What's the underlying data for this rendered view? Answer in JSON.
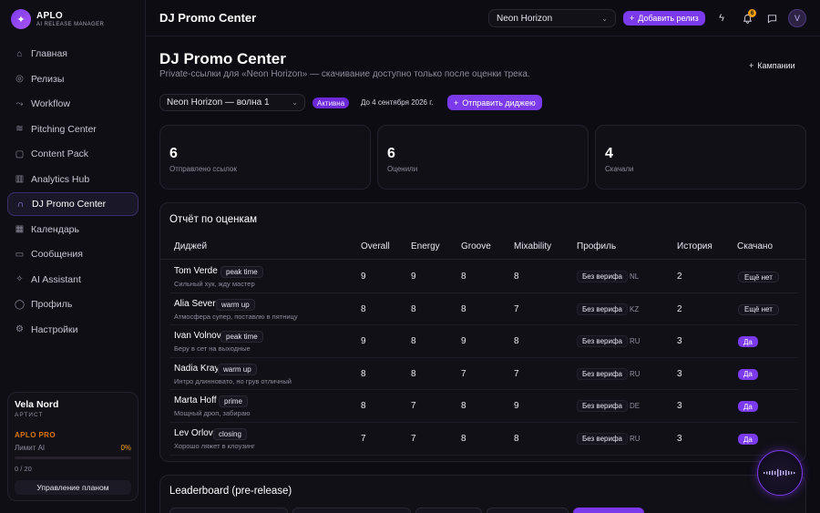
{
  "app": {
    "logo_name": "APLO",
    "logo_sub": "AI RELEASE MANAGER",
    "logo_icon": "sparkle-logo-icon"
  },
  "sidebar": {
    "items": [
      {
        "label": "Главная",
        "icon": "home-icon",
        "glyph": "⌂"
      },
      {
        "label": "Релизы",
        "icon": "disc-icon",
        "glyph": "◎"
      },
      {
        "label": "Workflow",
        "icon": "workflow-icon",
        "glyph": "⤳"
      },
      {
        "label": "Pitching Center",
        "icon": "broadcast-icon",
        "glyph": "≋"
      },
      {
        "label": "Content Pack",
        "icon": "package-icon",
        "glyph": "▢"
      },
      {
        "label": "Analytics Hub",
        "icon": "chart-icon",
        "glyph": "▥"
      },
      {
        "label": "DJ Promo Center",
        "icon": "headphones-icon",
        "glyph": "∩",
        "active": true
      },
      {
        "label": "Календарь",
        "icon": "calendar-icon",
        "glyph": "▦"
      },
      {
        "label": "Сообщения",
        "icon": "message-icon",
        "glyph": "▭"
      },
      {
        "label": "AI Assistant",
        "icon": "sparkle-icon",
        "glyph": "✧"
      },
      {
        "label": "Профиль",
        "icon": "user-icon",
        "glyph": "◯"
      },
      {
        "label": "Настройки",
        "icon": "gear-icon",
        "glyph": "⚙"
      }
    ],
    "plan": {
      "user_name": "Vela Nord",
      "role": "АРТИСТ",
      "plan_name": "APLO PRO",
      "limit_label": "Лимит AI",
      "limit_pct": "0%",
      "limit_fraction": 0,
      "count": "0 / 20",
      "manage_label": "Управление планом"
    }
  },
  "topbar": {
    "title": "DJ Promo Center",
    "release_select": "Neon Horizon",
    "add_release_label": "Добавить релиз",
    "notifications_count": "6",
    "avatar_letter": "V"
  },
  "main": {
    "title": "DJ Promo Center",
    "subtitle": "Private-ссылки для «Neon Horizon» — скачивание доступно только после оценки трека.",
    "campaigns_label": "Кампании",
    "wave_select": "Neon Horizon — волна 1",
    "status": "Активна",
    "deadline": "До 4 сентября 2026 г.",
    "send_digest_label": "Отправить диджею",
    "stats": [
      {
        "value": "6",
        "label": "Отправлено ссылок"
      },
      {
        "value": "6",
        "label": "Оценили"
      },
      {
        "value": "4",
        "label": "Скачали"
      }
    ],
    "report": {
      "title": "Отчёт по оценкам",
      "columns": [
        "Диджей",
        "Overall",
        "Energy",
        "Groove",
        "Mixability",
        "Профиль",
        "История",
        "Скачано"
      ],
      "rows": [
        {
          "name": "Tom Verde",
          "tag": "peak time",
          "comment": "Сильный хук, жду мастер",
          "overall": "9",
          "energy": "9",
          "groove": "8",
          "mix": "8",
          "profile": "Без верифа",
          "country": "NL",
          "history": "2",
          "downloaded": "Ещё нет",
          "dl": false
        },
        {
          "name": "Alia Sever",
          "tag": "warm up",
          "comment": "Атмосфера супер, поставлю в пятницу",
          "overall": "8",
          "energy": "8",
          "groove": "8",
          "mix": "7",
          "profile": "Без верифа",
          "country": "KZ",
          "history": "2",
          "downloaded": "Ещё нет",
          "dl": false
        },
        {
          "name": "Ivan Volnov",
          "tag": "peak time",
          "comment": "Беру в сет на выходные",
          "overall": "9",
          "energy": "8",
          "groove": "9",
          "mix": "8",
          "profile": "Без верифа",
          "country": "RU",
          "history": "3",
          "downloaded": "Да",
          "dl": true
        },
        {
          "name": "Nadia Kray",
          "tag": "warm up",
          "comment": "Интро длинновато, но грув отличный",
          "overall": "8",
          "energy": "8",
          "groove": "7",
          "mix": "7",
          "profile": "Без верифа",
          "country": "RU",
          "history": "3",
          "downloaded": "Да",
          "dl": true
        },
        {
          "name": "Marta Hoff",
          "tag": "prime",
          "comment": "Мощный дроп, забираю",
          "overall": "8",
          "energy": "7",
          "groove": "8",
          "mix": "9",
          "profile": "Без верифа",
          "country": "DE",
          "history": "3",
          "downloaded": "Да",
          "dl": true
        },
        {
          "name": "Lev Orlov",
          "tag": "closing",
          "comment": "Хорошо ляжет в клоузинг",
          "overall": "7",
          "energy": "7",
          "groove": "8",
          "mix": "8",
          "profile": "Без верифа",
          "country": "RU",
          "history": "3",
          "downloaded": "Да",
          "dl": true
        }
      ]
    },
    "leaderboard_title": "Leaderboard (pre-release)"
  },
  "colors": {
    "accent": "#7c3aed",
    "warning": "#f59e0b",
    "bg": "#0d0c12"
  }
}
